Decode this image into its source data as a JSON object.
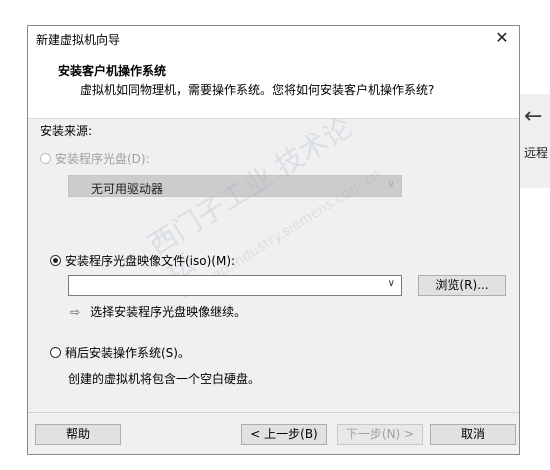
{
  "window": {
    "title": "新建虚拟机向导",
    "close_glyph": "✕"
  },
  "header": {
    "title": "安装客户机操作系统",
    "subtitle": "虚拟机如同物理机，需要操作系统。您将如何安装客户机操作系统?"
  },
  "install_source": {
    "label": "安装来源:",
    "option_disc": {
      "label": "安装程序光盘(D):",
      "selected": false,
      "enabled": false
    },
    "disc_select": {
      "value": "无可用驱动器",
      "enabled": false
    },
    "option_iso": {
      "label": "安装程序光盘映像文件(iso)(M):",
      "selected": true,
      "enabled": true
    },
    "iso_path": {
      "value": "",
      "placeholder": ""
    },
    "browse_label": "浏览(R)...",
    "hint_text": "选择安装程序光盘映像继续。",
    "option_later": {
      "label": "稍后安装操作系统(S)。",
      "selected": false,
      "enabled": true
    },
    "later_desc": "创建的虚拟机将包含一个空白硬盘。"
  },
  "footer": {
    "help_label": "帮助",
    "back_label": "< 上一步(B)",
    "next_label": "下一步(N) >",
    "cancel_label": "取消"
  },
  "side_panel": {
    "label": "远程",
    "icon": "arrow-left-icon"
  },
  "watermark": {
    "line1": "西门子工业 技术论坛",
    "line2": "www.ad.industry.siemens.com.cn"
  }
}
